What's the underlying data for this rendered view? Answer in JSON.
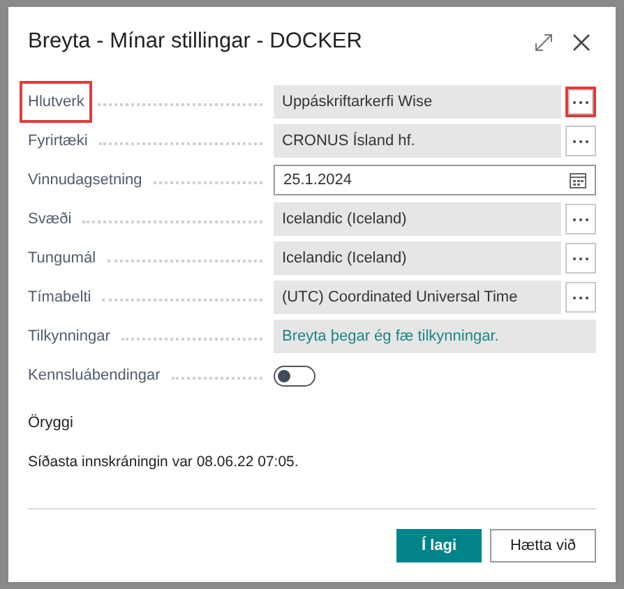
{
  "dialog": {
    "title": "Breyta - Mínar stillingar - DOCKER"
  },
  "fields": [
    {
      "kind": "lookup",
      "label": "Hlutverk",
      "value": "Uppáskriftarkerfi Wise",
      "label_highlighted": true,
      "button_highlighted": true
    },
    {
      "kind": "lookup",
      "label": "Fyrirtæki",
      "value": "CRONUS Ísland hf.",
      "label_highlighted": false,
      "button_highlighted": false
    },
    {
      "kind": "date",
      "label": "Vinnudagsetning",
      "value": "25.1.2024",
      "label_highlighted": false
    },
    {
      "kind": "lookup",
      "label": "Svæði",
      "value": "Icelandic (Iceland)",
      "label_highlighted": false,
      "button_highlighted": false
    },
    {
      "kind": "lookup",
      "label": "Tungumál",
      "value": "Icelandic (Iceland)",
      "label_highlighted": false,
      "button_highlighted": false
    },
    {
      "kind": "lookup",
      "label": "Tímabelti",
      "value": "(UTC) Coordinated Universal Time",
      "label_highlighted": false,
      "button_highlighted": false
    },
    {
      "kind": "link",
      "label": "Tilkynningar",
      "value": "Breyta þegar ég fæ tilkynningar.",
      "label_highlighted": false
    },
    {
      "kind": "toggle",
      "label": "Kennsluábendingar",
      "on": false,
      "label_highlighted": false
    }
  ],
  "security": {
    "heading": "Öryggi",
    "text": "Síðasta innskráningin var 08.06.22 07:05."
  },
  "buttons": [
    {
      "label": "Í lagi",
      "primary": true
    },
    {
      "label": "Hætta við",
      "primary": false
    }
  ]
}
